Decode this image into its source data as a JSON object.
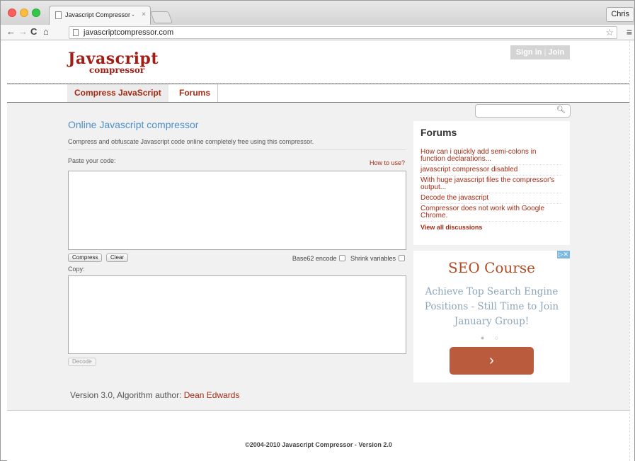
{
  "browser": {
    "tab_title": "Javascript Compressor - ",
    "tab_close": "×",
    "profile_name": "Chris",
    "url": "javascriptcompressor.com",
    "back_glyph": "←",
    "forward_glyph": "→",
    "reload_glyph": "C",
    "home_glyph": "⌂",
    "star_glyph": "☆",
    "menu_glyph": "≡"
  },
  "header": {
    "logo_line1": "Javascript",
    "logo_line2": "compressor",
    "signin_label": "Sign in",
    "join_label": "Join",
    "separator": "|"
  },
  "nav": {
    "items": [
      {
        "label": "Compress JavaScript"
      },
      {
        "label": "Forums"
      }
    ]
  },
  "main": {
    "title": "Online Javascript compressor",
    "description": "Compress and obfuscate Javascript code online completely free using this compressor.",
    "paste_label": "Paste your code:",
    "how_to_use": "How to use?",
    "input_value": "",
    "compress_label": "Compress",
    "clear_label": "Clear",
    "base62_label": "Base62 encode",
    "shrink_label": "Shrink variables",
    "copy_label": "Copy:",
    "output_value": "",
    "decode_label": "Decode",
    "version_text": "Version 3.0, Algorithm author: ",
    "author_link": "Dean Edwards"
  },
  "sidebar": {
    "search_value": "",
    "search_icon": "magnifier-icon",
    "forums_title": "Forums",
    "forum_items": [
      {
        "label": "How can i quickly add semi-colons in function declarations..."
      },
      {
        "label": "javascript compressor disabled"
      },
      {
        "label": "With huge javascript files the compressor's output..."
      },
      {
        "label": "Decode the javascript"
      },
      {
        "label": "Compressor does not work with Google Chrome."
      }
    ],
    "view_all": "View all discussions"
  },
  "ad": {
    "choice_badge": "▷✕",
    "title": "SEO Course",
    "body": "Achieve Top Search Engine Positions - Still Time to Join January Group!",
    "dots": "● ○",
    "button_glyph": "›"
  },
  "footer": {
    "text": "©2004-2010 Javascript Compressor - Version 2.0"
  },
  "colors": {
    "accent_red": "#a42b14",
    "title_blue": "#4d8fca",
    "ad_orange": "#b95b3c"
  }
}
